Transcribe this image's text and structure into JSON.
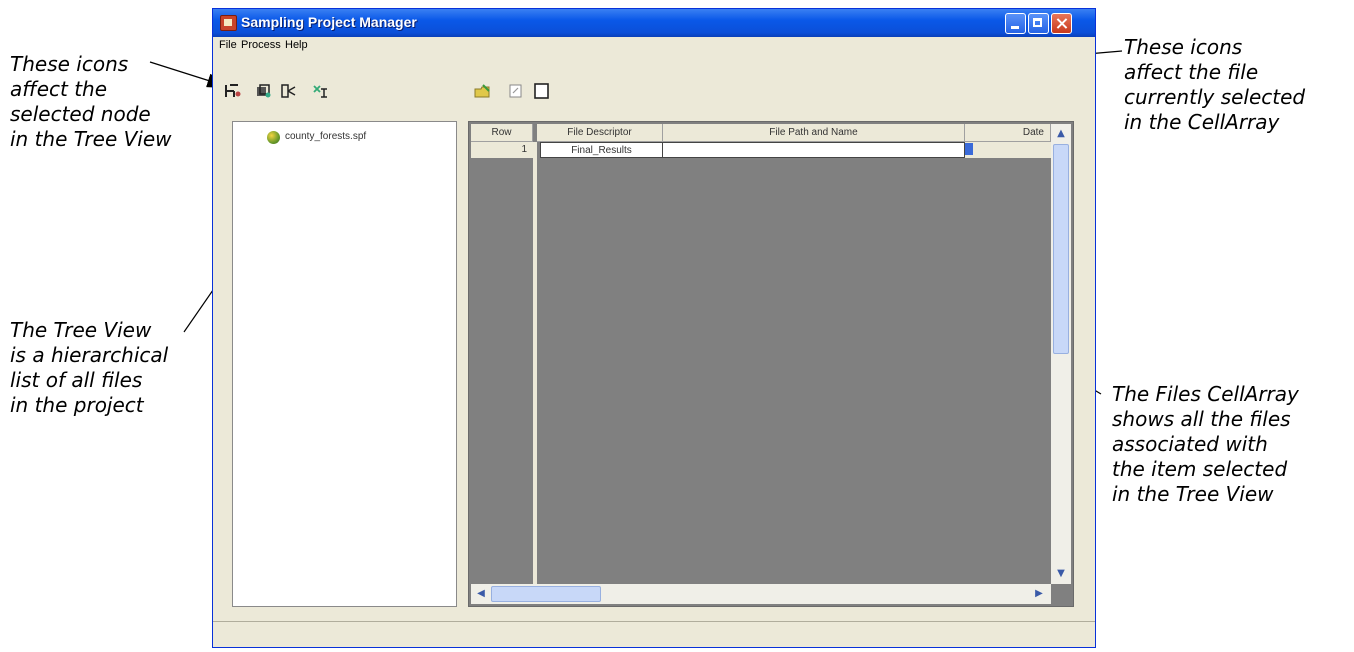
{
  "callouts": {
    "top_left": [
      "These icons",
      "affect the",
      "selected node",
      "in the Tree View"
    ],
    "top_right": [
      "These icons",
      "affect the file",
      "currently selected",
      "in the CellArray"
    ],
    "mid_left": [
      "The Tree View",
      "is a hierarchical",
      "list of all files",
      "in the project"
    ],
    "mid_right": [
      "The Files CellArray",
      "shows all the files",
      "associated with",
      "the item selected",
      "in the Tree View"
    ]
  },
  "window": {
    "title": "Sampling Project Manager"
  },
  "menu": [
    "File",
    "Process",
    "Help"
  ],
  "toolbar": {
    "node_icons": [
      "new-node-icon",
      "open-node-icon",
      "connect-node-icon",
      "edit-node-icon"
    ],
    "file_icons": [
      "open-file-icon",
      "view-file-icon",
      "properties-icon"
    ]
  },
  "tree": {
    "root_label": "county_forests.spf"
  },
  "cellarray": {
    "columns": [
      "Row",
      "File Descriptor",
      "File Path and Name",
      "Date"
    ],
    "rows": [
      {
        "row": "1",
        "descriptor": "Final_Results",
        "path": "",
        "date": ""
      }
    ]
  },
  "colors": {
    "window_bg": "#ECE9D8",
    "titlebar": "#0a58e8",
    "cellarray_bg": "#808080"
  }
}
